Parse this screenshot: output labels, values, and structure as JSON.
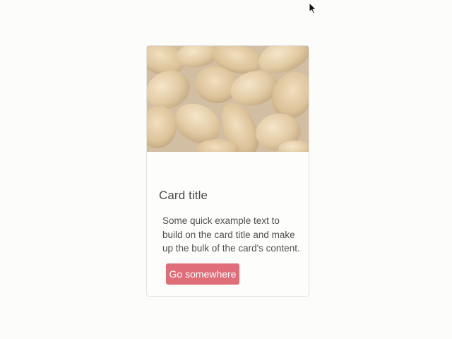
{
  "card": {
    "image_subject": "peanuts",
    "title": "Card title",
    "text": "Some quick example text to build on the card title and make up the bulk of the card's content.",
    "button_label": "Go somewhere"
  },
  "colors": {
    "page_background": "#fcfcfb",
    "card_background": "#fdfdfc",
    "card_border": "#e3e3e1",
    "button_background": "#df6e78",
    "button_text": "#ffffff",
    "title_text": "#4a4a4a",
    "body_text": "#4f4f4f"
  },
  "cursor": {
    "icon": "mouse-pointer-icon"
  }
}
